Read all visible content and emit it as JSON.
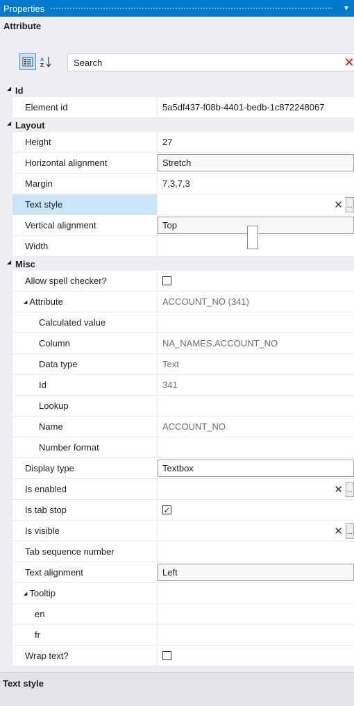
{
  "window": {
    "title": "Properties",
    "dropdown_glyph": "▼"
  },
  "object_name": "Attribute",
  "toolbar": {
    "categorized_icon": "categorized-icon",
    "alphabetical_icon": "alphabetical-icon",
    "search_placeholder": "Search",
    "clear_glyph": "✕"
  },
  "categories": {
    "id": {
      "label": "Id"
    },
    "layout": {
      "label": "Layout"
    },
    "misc": {
      "label": "Misc"
    }
  },
  "props": {
    "element_id": {
      "label": "Element id",
      "value": "5a5df437-f08b-4401-bedb-1c872248067"
    },
    "height": {
      "label": "Height",
      "value": "27"
    },
    "horizontal_alignment": {
      "label": "Horizontal alignment",
      "value": "Stretch"
    },
    "margin": {
      "label": "Margin",
      "value": "7,3,7,3"
    },
    "text_style": {
      "label": "Text style",
      "value": ""
    },
    "vertical_alignment": {
      "label": "Vertical alignment",
      "value": "Top"
    },
    "width": {
      "label": "Width",
      "value": ""
    },
    "allow_spell_checker": {
      "label": "Allow spell checker?",
      "checked": false
    },
    "attribute": {
      "label": "Attribute",
      "value": "ACCOUNT_NO (341)"
    },
    "calculated_value": {
      "label": "Calculated value",
      "value": ""
    },
    "column": {
      "label": "Column",
      "value": "NA_NAMES.ACCOUNT_NO"
    },
    "data_type": {
      "label": "Data type",
      "value": "Text"
    },
    "attr_id": {
      "label": "Id",
      "value": "341"
    },
    "lookup": {
      "label": "Lookup",
      "value": ""
    },
    "name": {
      "label": "Name",
      "value": "ACCOUNT_NO"
    },
    "number_format": {
      "label": "Number format",
      "value": ""
    },
    "display_type": {
      "label": "Display type",
      "value": "Textbox"
    },
    "is_enabled": {
      "label": "Is enabled",
      "value": ""
    },
    "is_tab_stop": {
      "label": "Is tab stop",
      "checked": true
    },
    "is_visible": {
      "label": "Is visible",
      "value": ""
    },
    "tab_sequence_number": {
      "label": "Tab sequence number",
      "value": ""
    },
    "text_alignment": {
      "label": "Text alignment",
      "value": "Left"
    },
    "tooltip": {
      "label": "Tooltip",
      "value": ""
    },
    "tooltip_en": {
      "label": "en",
      "value": ""
    },
    "tooltip_fr": {
      "label": "fr",
      "value": ""
    },
    "wrap_text": {
      "label": "Wrap text?",
      "checked": false
    }
  },
  "glyphs": {
    "reset": "✕",
    "ellipsis": "...",
    "check": "✓"
  },
  "description": {
    "title": "Text style"
  }
}
